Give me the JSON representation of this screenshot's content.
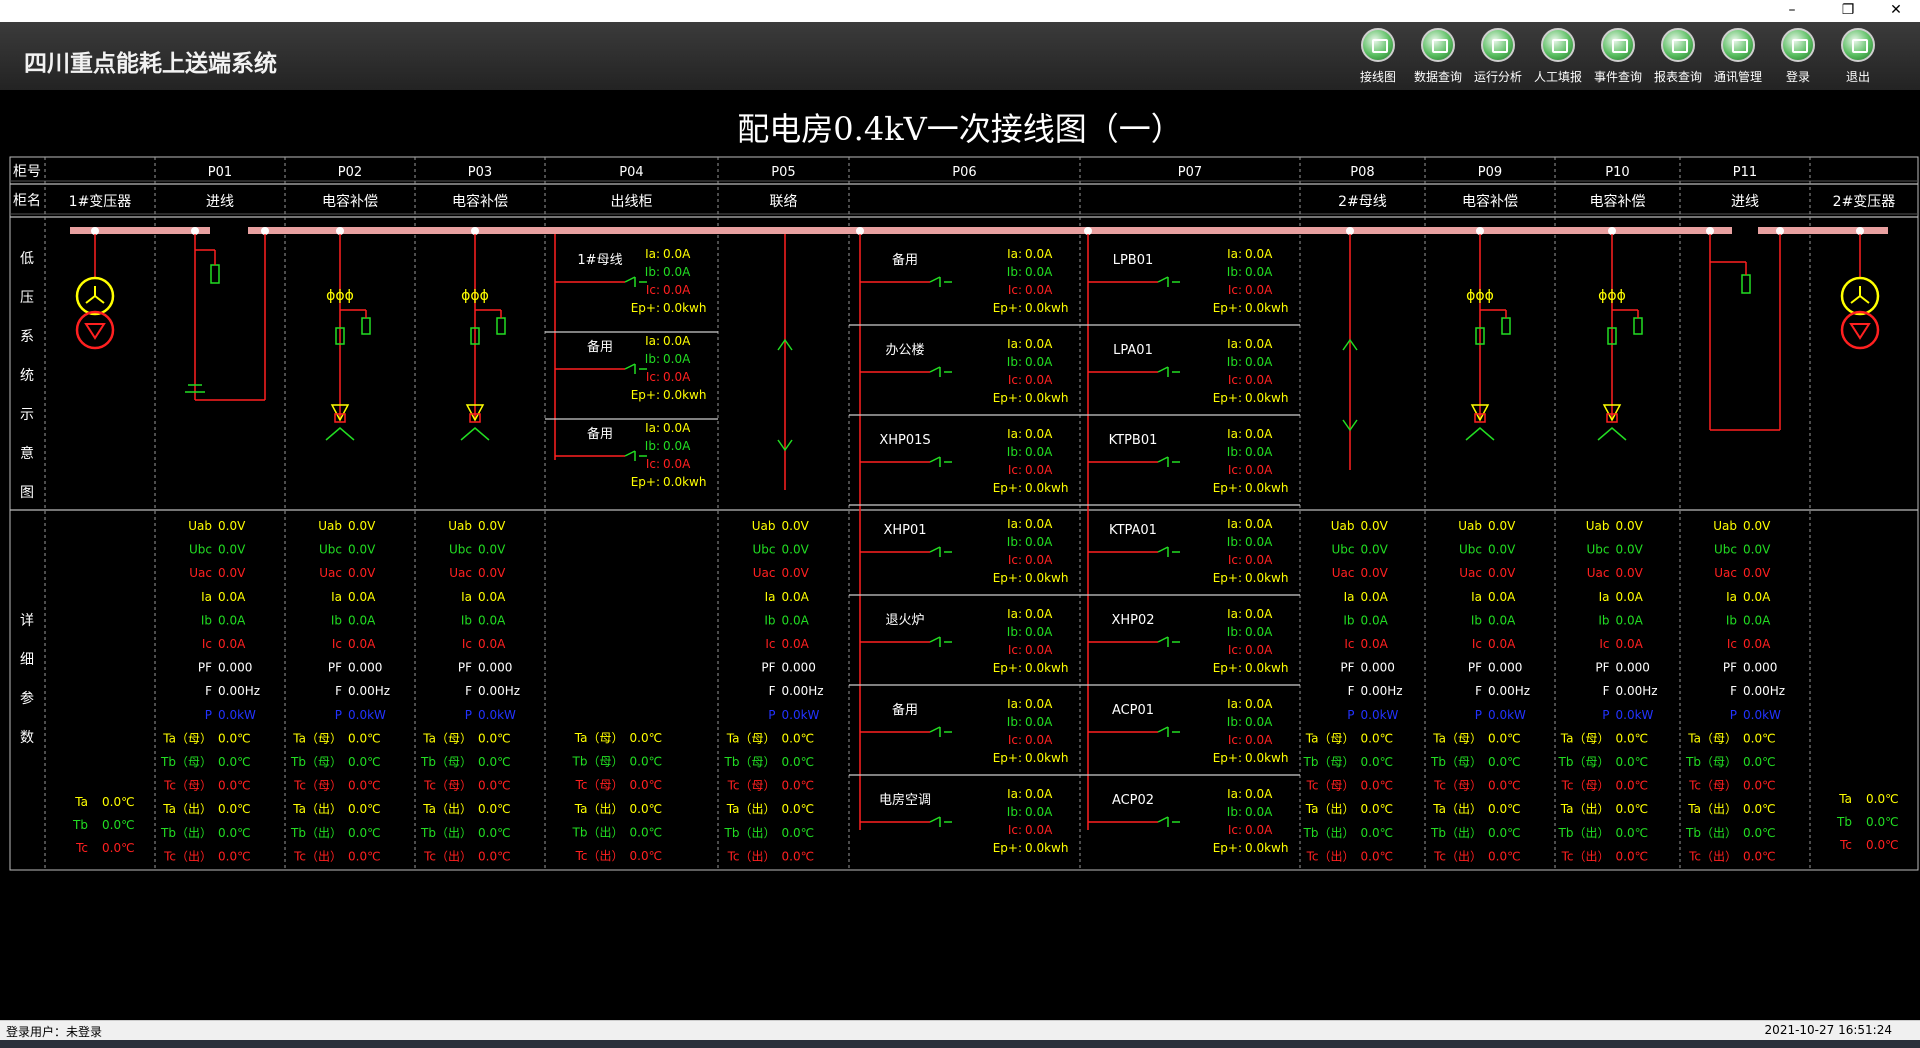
{
  "app": {
    "title": "四川重点能耗上送端系统"
  },
  "window": {
    "min": "–",
    "restore": "❐",
    "close": "✕"
  },
  "toolbar": [
    {
      "label": "接线图",
      "icon": "wiring-diagram-icon"
    },
    {
      "label": "数据查询",
      "icon": "data-query-icon"
    },
    {
      "label": "运行分析",
      "icon": "run-analysis-icon"
    },
    {
      "label": "人工填报",
      "icon": "manual-fill-icon"
    },
    {
      "label": "事件查询",
      "icon": "event-query-icon"
    },
    {
      "label": "报表查询",
      "icon": "report-query-icon"
    },
    {
      "label": "通讯管理",
      "icon": "comm-manage-icon"
    },
    {
      "label": "登录",
      "icon": "login-icon"
    },
    {
      "label": "退出",
      "icon": "exit-icon"
    }
  ],
  "page": {
    "title": "配电房0.4kV一次接线图（一）"
  },
  "grid": {
    "row_label_no": "柜号",
    "row_label_name": "柜名",
    "sect_lv": [
      "低",
      "压",
      "系",
      "统",
      "示",
      "意",
      "图"
    ],
    "sect_detail": [
      "详",
      "细",
      "参",
      "数"
    ],
    "cabinets": [
      {
        "no": "",
        "name": "1#变压器"
      },
      {
        "no": "P01",
        "name": "进线"
      },
      {
        "no": "P02",
        "name": "电容补偿"
      },
      {
        "no": "P03",
        "name": "电容补偿"
      },
      {
        "no": "P04",
        "name": "出线柜"
      },
      {
        "no": "P05",
        "name": "联络"
      },
      {
        "no": "P06",
        "name": ""
      },
      {
        "no": "P07",
        "name": ""
      },
      {
        "no": "P08",
        "name": "2#母线"
      },
      {
        "no": "P09",
        "name": "电容补偿"
      },
      {
        "no": "P10",
        "name": "电容补偿"
      },
      {
        "no": "P11",
        "name": "进线"
      },
      {
        "no": "",
        "name": "2#变压器"
      }
    ]
  },
  "feeders": {
    "P04": [
      "1#母线",
      "备用",
      "备用"
    ],
    "P06": [
      "备用",
      "办公楼",
      "XHP01S",
      "XHP01",
      "退火炉",
      "备用",
      "电房空调"
    ],
    "P07": [
      "LPB01",
      "LPA01",
      "KTPB01",
      "KTPA01",
      "XHP02",
      "ACP01",
      "ACP02"
    ]
  },
  "feeder_vals": [
    {
      "k": "Ia:",
      "v": "0.0A",
      "c": "#ffff00"
    },
    {
      "k": "Ib:",
      "v": "0.0A",
      "c": "#22dd22"
    },
    {
      "k": "Ic:",
      "v": "0.0A",
      "c": "#ff2020"
    },
    {
      "k": "Ep+:",
      "v": "0.0kwh",
      "c": "#ffff00"
    }
  ],
  "cabinet_params": [
    {
      "k": "Uab",
      "v": "0.0V",
      "c": "#ffff00"
    },
    {
      "k": "Ubc",
      "v": "0.0V",
      "c": "#22dd22"
    },
    {
      "k": "Uac",
      "v": "0.0V",
      "c": "#ff2020"
    },
    {
      "k": "Ia",
      "v": "0.0A",
      "c": "#ffff00"
    },
    {
      "k": "Ib",
      "v": "0.0A",
      "c": "#22dd22"
    },
    {
      "k": "Ic",
      "v": "0.0A",
      "c": "#ff2020"
    },
    {
      "k": "PF",
      "v": "0.000",
      "c": "#ffffff"
    },
    {
      "k": "F",
      "v": "0.00Hz",
      "c": "#ffffff"
    },
    {
      "k": "P",
      "v": "0.0kW",
      "c": "#2233ff"
    },
    {
      "k": "Ta（母）",
      "v": "0.0℃",
      "c": "#ffff00"
    },
    {
      "k": "Tb（母）",
      "v": "0.0℃",
      "c": "#22dd22"
    },
    {
      "k": "Tc（母）",
      "v": "0.0℃",
      "c": "#ff2020"
    },
    {
      "k": "Ta（出）",
      "v": "0.0℃",
      "c": "#ffff00"
    },
    {
      "k": "Tb（出）",
      "v": "0.0℃",
      "c": "#22dd22"
    },
    {
      "k": "Tc（出）",
      "v": "0.0℃",
      "c": "#ff2020"
    }
  ],
  "temp_params": [
    {
      "k": "Ta",
      "v": "0.0℃",
      "c": "#ffff00"
    },
    {
      "k": "Tb",
      "v": "0.0℃",
      "c": "#22dd22"
    },
    {
      "k": "Tc",
      "v": "0.0℃",
      "c": "#ff2020"
    }
  ],
  "status": {
    "user": "登录用户：未登录",
    "time": "2021-10-27 16:51:24"
  }
}
